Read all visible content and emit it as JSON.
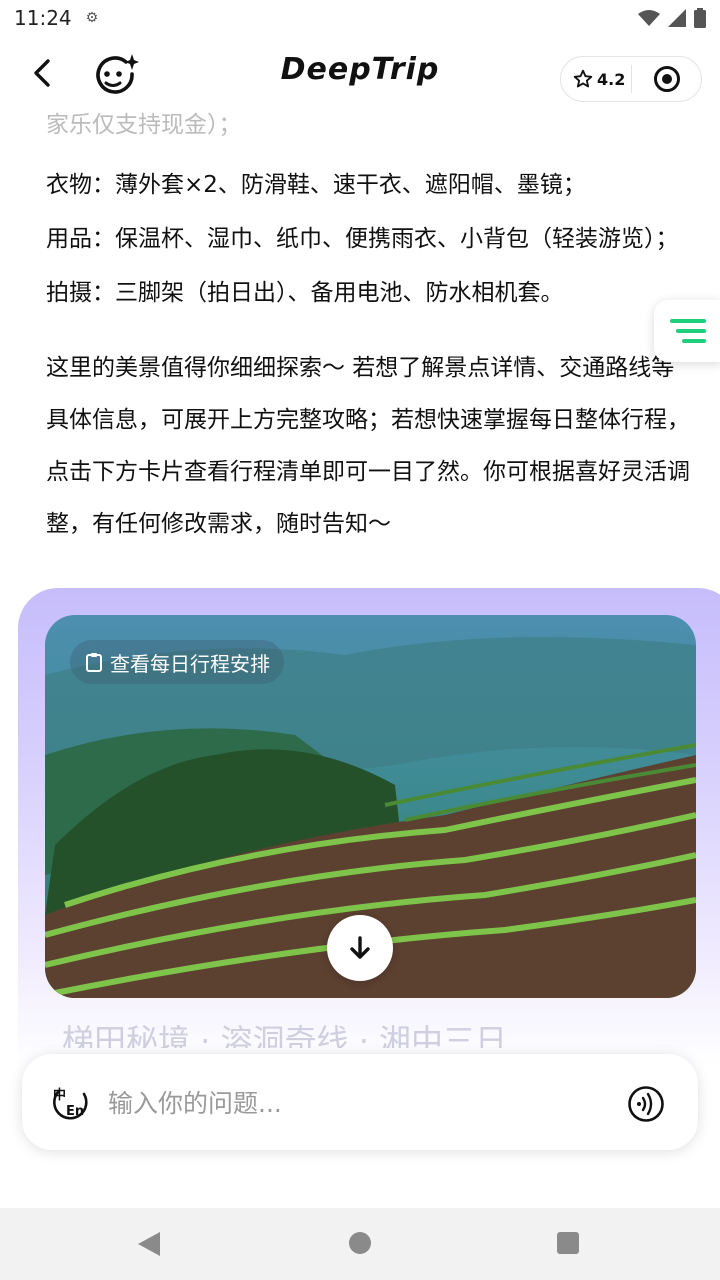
{
  "status": {
    "time": "11:24",
    "rating": "4.2"
  },
  "header": {
    "title": "DeepTrip"
  },
  "content": {
    "faded_line": "家乐仅支持现金）；",
    "clothing": "衣物：薄外套×2、防滑鞋、速干衣、遮阳帽、墨镜；",
    "items": "用品：保温杯、湿巾、纸巾、便携雨衣、小背包（轻装游览）；",
    "photo_gear": "拍摄：三脚架（拍日出）、备用电池、防水相机套。",
    "summary": "这里的美景值得你细细探索〜 若想了解景点详情、交通路线等具体信息，可展开上方完整攻略；若想快速掌握每日整体行程，点击下方卡片查看行程清单即可一目了然。你可根据喜好灵活调整，有任何修改需求，随时告知〜"
  },
  "card": {
    "itinerary_label": "查看每日行程安排",
    "peek_text": "梯田秘境 · 溶洞奇线 · 湘中三日"
  },
  "input": {
    "placeholder": "输入你的问题..."
  },
  "icons": {
    "back": "chevron-left-icon",
    "bot": "bot-face-icon",
    "star": "star-icon",
    "target": "target-icon",
    "list": "list-icon",
    "clipboard": "clipboard-icon",
    "down": "arrow-down-icon",
    "lang": "language-switch-icon",
    "voice": "voice-icon"
  },
  "colors": {
    "accent_green": "#1fd07a",
    "card_gradient_top": "#c6bdfb"
  }
}
